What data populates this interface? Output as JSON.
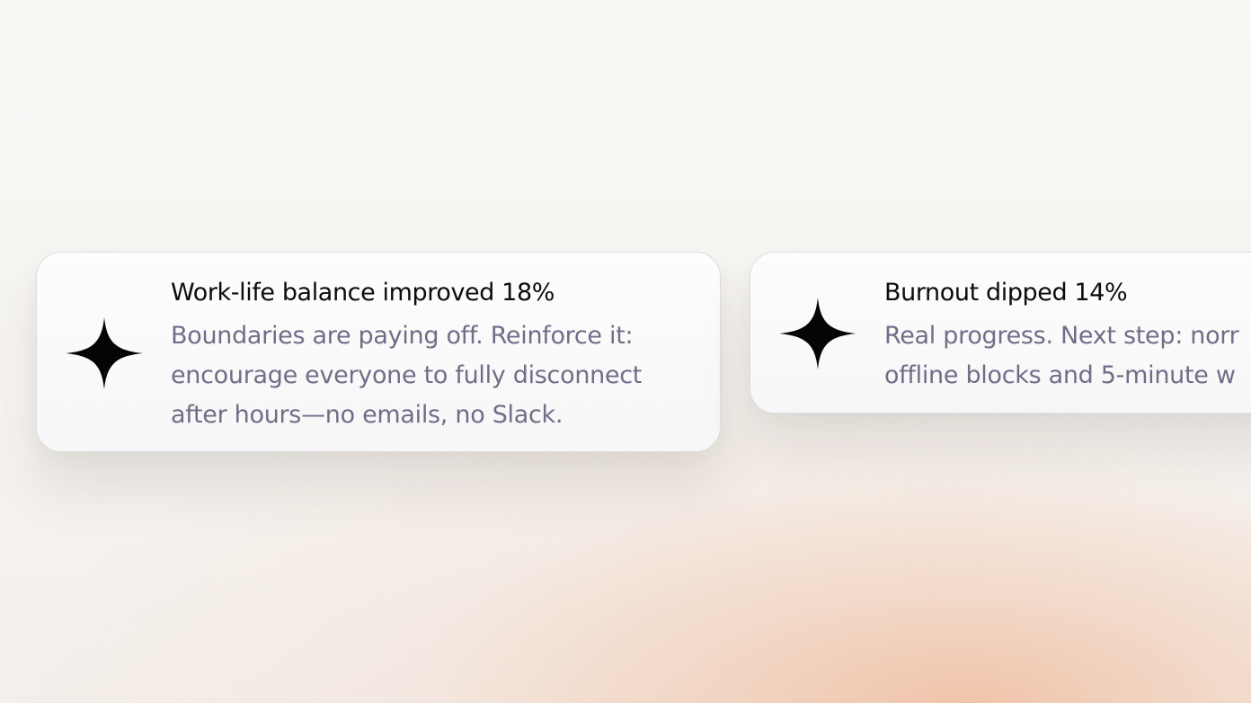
{
  "cards": [
    {
      "icon": "sparkle-icon",
      "title": "Work-life balance improved 18%",
      "description_lines": [
        "Boundaries are paying off. Reinforce it:",
        "encourage everyone to fully disconnect",
        "after hours—no emails, no Slack."
      ]
    },
    {
      "icon": "sparkle-icon",
      "title": "Burnout dipped 14%",
      "description_lines": [
        "Real progress. Next step: norr",
        "offline blocks and 5-minute w"
      ]
    }
  ],
  "colors": {
    "title": "#0b0b10",
    "description": "#6f6e87",
    "card_background": "#fbfbfc",
    "card_border": "#dcdcdf",
    "glow": "#eeaa82"
  }
}
